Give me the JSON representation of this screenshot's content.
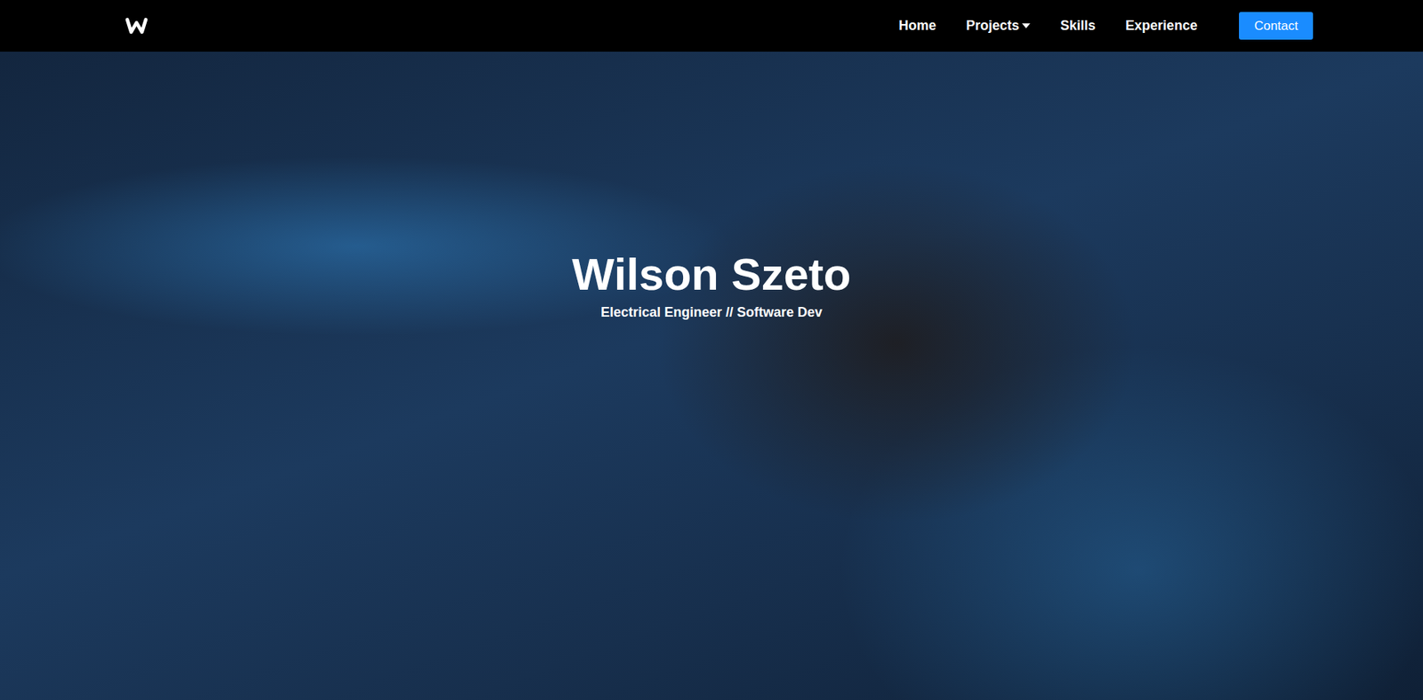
{
  "nav": {
    "items": [
      {
        "label": "Home",
        "dropdown": false
      },
      {
        "label": "Projects",
        "dropdown": true
      },
      {
        "label": "Skills",
        "dropdown": false
      },
      {
        "label": "Experience",
        "dropdown": false
      }
    ],
    "cta": "Contact"
  },
  "hero": {
    "title": "Wilson Szeto",
    "subtitle": "Electrical Engineer // Software Dev"
  }
}
